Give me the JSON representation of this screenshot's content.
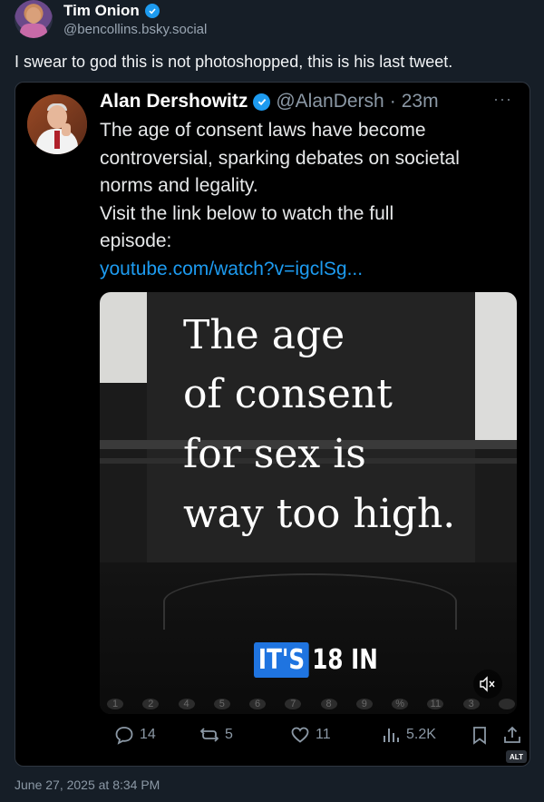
{
  "post": {
    "author_name": "Tim Onion",
    "author_handle": "@bencollins.bsky.social",
    "text": "I swear to god this is not photoshopped, this is his last tweet.",
    "timestamp": "June 27, 2025 at 8:34 PM"
  },
  "quoted": {
    "author_name": "Alan Dershowitz",
    "author_handle": "@AlanDersh",
    "separator": "·",
    "time": "23m",
    "more": "···",
    "body_lines": [
      "The age of consent laws have become",
      "controversial, sparking debates on societal",
      "norms and legality.",
      "Visit the link below to watch the full",
      "episode:"
    ],
    "link": "youtube.com/watch?v=igclSg...",
    "media": {
      "lines": [
        "The age",
        "of consent",
        "for sex is",
        "way too high."
      ],
      "badge_highlight": "IT'S",
      "badge_rest": "18 IN",
      "keys": [
        "1",
        "2",
        "4",
        "5",
        "6",
        "7",
        "8",
        "9",
        "%",
        "11",
        "3",
        ""
      ]
    },
    "actions": {
      "replies": "14",
      "reposts": "5",
      "likes": "11",
      "views": "5.2K"
    },
    "alt_label": "ALT"
  },
  "colors": {
    "background": "#161e27",
    "card": "#000000",
    "link": "#1d9bf0",
    "verified": "#1d9bf0",
    "muted": "#8b98a5"
  }
}
